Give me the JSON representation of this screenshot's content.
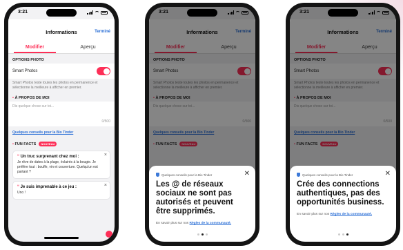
{
  "status": {
    "time": "3:21"
  },
  "header": {
    "title": "Informations",
    "done": "Terminé"
  },
  "tabs": [
    {
      "label": "Modifier"
    },
    {
      "label": "Aperçu"
    }
  ],
  "photo_options": {
    "section": "OPTIONS PHOTO",
    "smart_photos": "Smart Photos",
    "description": "Smart Photos teste toutes les photos en permanence et sélectionne la meilleure à afficher en premier."
  },
  "about": {
    "section": "À PROPOS DE MOI",
    "placeholder": "Dis quelque chose sur toi...",
    "counter": "0/500",
    "tips_link": "Quelques conseils pour la Bio Tinder"
  },
  "fun_facts": {
    "section": "FUN FACTS",
    "badge": "NOUVEAU",
    "cards": [
      {
        "question": "Un truc surprenant chez moi :",
        "answer": "Je rêve de dates à la plage, éclairés à la bougie. Je préfère tout : bouffe, vin et couverture. Quelqu'un est partant ?"
      },
      {
        "question": "Je suis imprenable à ce jeu :",
        "answer": "Uno !"
      }
    ]
  },
  "sheets": [
    {
      "heading": "Quelques conseils pour la Bio Tinder",
      "text": "Les @ de réseaux sociaux ne sont pas autorisés et peuvent être supprimés.",
      "footer_prefix": "En savoir plus sur nos",
      "footer_link": "Règles de la communauté.",
      "page": 2,
      "total": 3
    },
    {
      "heading": "Quelques conseils pour la Bio Tinder",
      "text": "Crée des connections authentiques, pas des opportunités business.",
      "footer_prefix": "En savoir plus sur nos",
      "footer_link": "Règles de la communauté.",
      "page": 3,
      "total": 3
    }
  ],
  "colors": {
    "accent": "#fd2f57",
    "link": "#2b6fd6"
  }
}
